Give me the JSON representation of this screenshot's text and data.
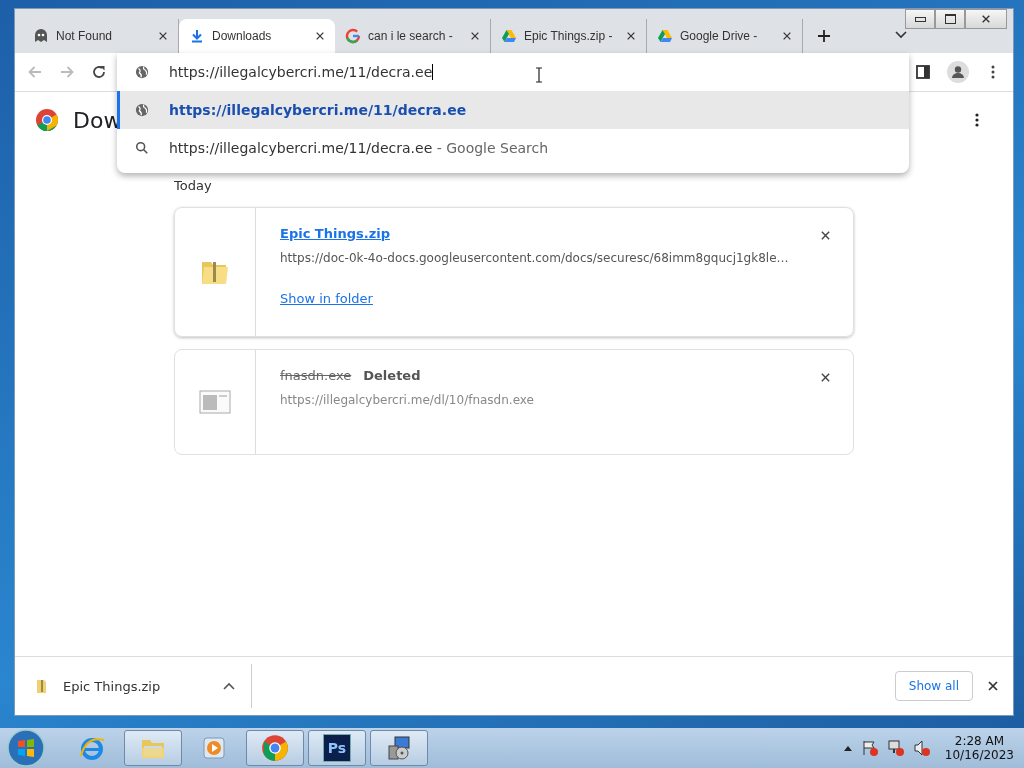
{
  "tabs": [
    {
      "title": "Not Found",
      "kind": "ghost",
      "selected": false
    },
    {
      "title": "Downloads",
      "kind": "download",
      "selected": true
    },
    {
      "title": "can i le search -",
      "kind": "google",
      "selected": false
    },
    {
      "title": "Epic Things.zip -",
      "kind": "drive",
      "selected": false
    },
    {
      "title": "Google Drive -",
      "kind": "drive",
      "selected": false
    }
  ],
  "omnibox": {
    "value": "https://illegalcybercri.me/11/decra.ee"
  },
  "suggestions": [
    {
      "kind": "url",
      "text": "https://illegalcybercri.me/11/decra.ee",
      "selected": true
    },
    {
      "kind": "search",
      "text": "https://illegalcybercri.me/11/decra.ee",
      "suffix": "- Google Search",
      "selected": false
    }
  ],
  "page": {
    "title": "Dow",
    "section": "Today",
    "downloads": [
      {
        "kind": "zip",
        "name": "Epic Things.zip",
        "deleted": false,
        "url": "https://doc-0k-4o-docs.googleusercontent.com/docs/securesc/68imm8gqucj1gk8le…",
        "action": "Show in folder"
      },
      {
        "kind": "exe",
        "name": "fnasdn.exe",
        "deleted": true,
        "status": "Deleted",
        "url": "https://illegalcybercri.me/dl/10/fnasdn.exe"
      }
    ]
  },
  "shelf": {
    "file": "Epic Things.zip",
    "show_all": "Show all"
  },
  "taskbar": {
    "apps": [
      {
        "kind": "ie",
        "running": false
      },
      {
        "kind": "explorer",
        "running": true
      },
      {
        "kind": "media",
        "running": false
      },
      {
        "kind": "chrome",
        "running": true
      },
      {
        "kind": "photoshop",
        "label": "Ps",
        "running": true
      },
      {
        "kind": "installer",
        "running": true
      }
    ],
    "clock": {
      "time": "2:28 AM",
      "date": "10/16/2023"
    }
  }
}
